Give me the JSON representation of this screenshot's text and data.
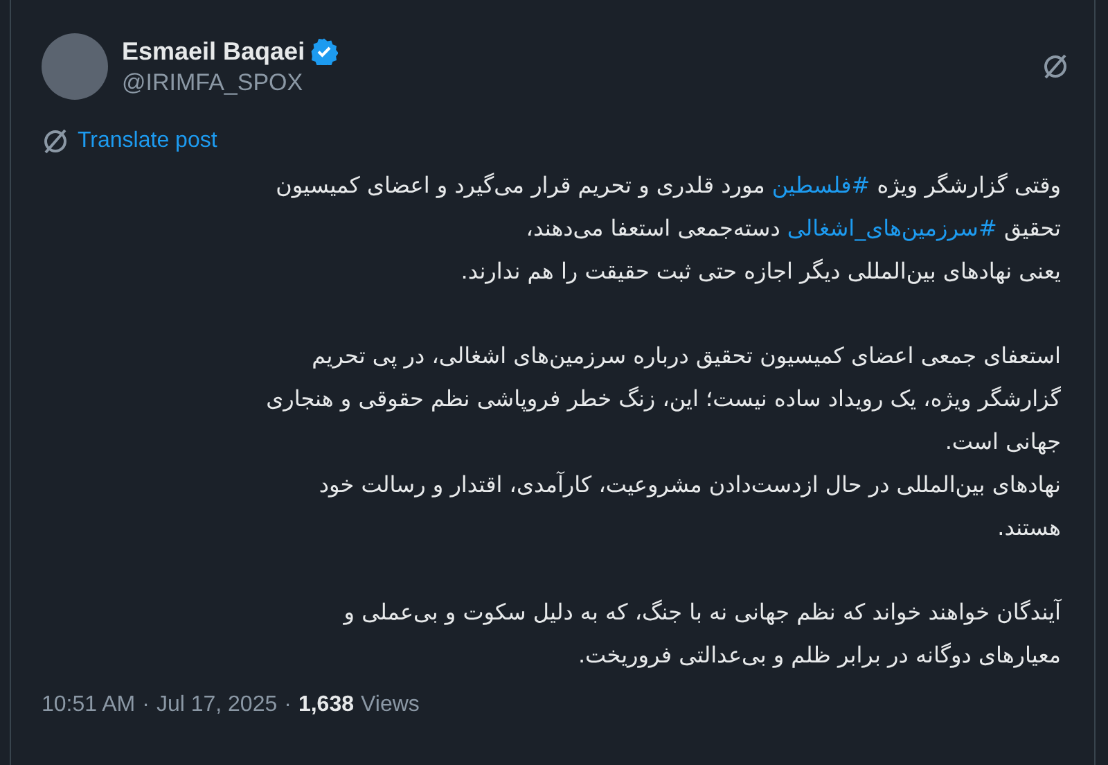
{
  "author": {
    "name": "Esmaeil Baqaei",
    "handle": "@IRIMFA_SPOX",
    "verified": true
  },
  "translate": {
    "label": "Translate post"
  },
  "paragraphs": [
    {
      "lines": [
        [
          {
            "kind": "text",
            "text": "وقتی گزارشگر ویژه "
          },
          {
            "kind": "hashtag",
            "text": "#فلسطین"
          },
          {
            "kind": "text",
            "text": " مورد قلدری و تحریم قرار می‌گیرد و اعضای کمیسیون"
          }
        ],
        [
          {
            "kind": "text",
            "text": "تحقیق "
          },
          {
            "kind": "hashtag",
            "text": "#سرزمین‌های_اشغالی"
          },
          {
            "kind": "text",
            "text": " دسته‌جمعی استعفا می‌دهند،"
          }
        ],
        [
          {
            "kind": "text",
            "text": "یعنی نهادهای بین‌المللی دیگر اجازه حتی ثبت حقیقت را هم ندارند."
          }
        ]
      ]
    },
    {
      "lines": [
        [
          {
            "kind": "text",
            "text": "استعفای جمعی اعضای کمیسیون تحقیق درباره سرزمین‌های اشغالی، در پی تحریم"
          }
        ],
        [
          {
            "kind": "text",
            "text": "گزارشگر ویژه، یک رویداد ساده نیست؛ این، زنگ خطر فروپاشی نظم حقوقی و هنجاری"
          }
        ],
        [
          {
            "kind": "text",
            "text": "جهانی است."
          }
        ],
        [
          {
            "kind": "text",
            "text": "نهادهای بین‌المللی در حال ازدست‌دادن مشروعیت، کارآمدی، اقتدار و رسالت خود"
          }
        ],
        [
          {
            "kind": "text",
            "text": "هستند."
          }
        ]
      ]
    },
    {
      "lines": [
        [
          {
            "kind": "text",
            "text": "آیندگان خواهند خواند که نظم جهانی نه با جنگ، که به دلیل سکوت و بی‌عملی و"
          }
        ],
        [
          {
            "kind": "text",
            "text": "معیارهای دوگانه در برابر ظلم و بی‌عدالتی فروریخت."
          }
        ]
      ]
    }
  ],
  "meta": {
    "time": "10:51 AM",
    "separator_1": "·",
    "date": "Jul 17, 2025",
    "separator_2": "·",
    "views_count": "1,638",
    "views_label": "Views"
  }
}
